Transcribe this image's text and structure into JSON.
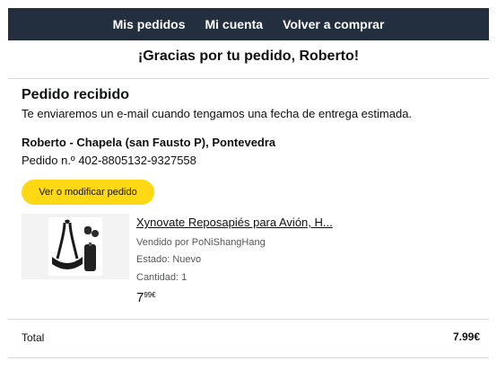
{
  "nav": {
    "items": [
      "Mis pedidos",
      "Mi cuenta",
      "Volver a comprar"
    ]
  },
  "thanks_text": "¡Gracias por tu pedido, Roberto!",
  "order": {
    "status_title": "Pedido recibido",
    "status_message": "Te enviaremos un e-mail cuando tengamos una fecha de entrega estimada.",
    "address": "Roberto - Chapela (san Fausto P), Pontevedra",
    "order_number_label": "Pedido n.º",
    "order_number": "402-8805132-9327558",
    "modify_button": "Ver o modificar pedido"
  },
  "product": {
    "title": "Xynovate Reposapiés para Avión, H...",
    "seller": "Vendido por PoNiShangHang",
    "condition": "Estado: Nuevo",
    "quantity": "Cantidad: 1",
    "price_whole": "7",
    "price_fraction": "99€",
    "image_icon": "footrest-product-image"
  },
  "summary": {
    "total_label": "Total",
    "total_value": "7.99€"
  },
  "colors": {
    "nav_bg": "#232f3e",
    "button_bg": "#ffd814",
    "divider": "#d5d9d9"
  }
}
